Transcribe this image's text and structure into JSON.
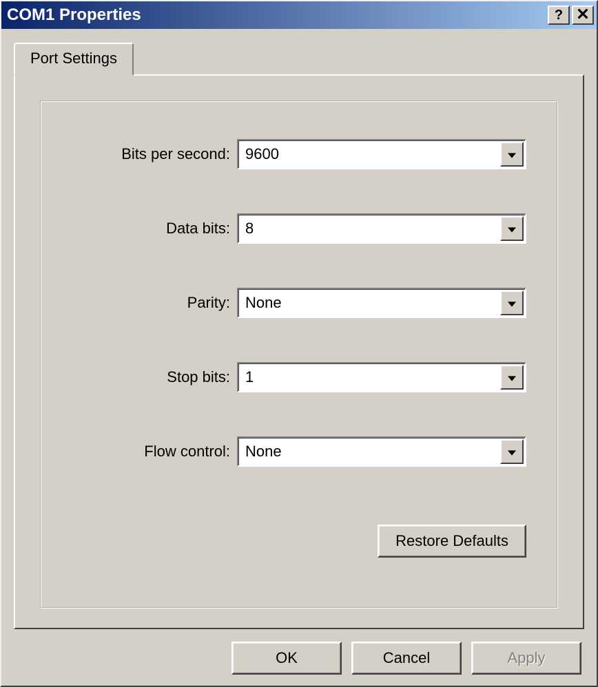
{
  "window": {
    "title": "COM1 Properties"
  },
  "tab": {
    "label": "Port Settings"
  },
  "fields": {
    "bits_per_second": {
      "label": "Bits per second:",
      "value": "9600"
    },
    "data_bits": {
      "label": "Data bits:",
      "value": "8"
    },
    "parity": {
      "label": "Parity:",
      "value": "None"
    },
    "stop_bits": {
      "label": "Stop bits:",
      "value": "1"
    },
    "flow_control": {
      "label": "Flow control:",
      "value": "None"
    }
  },
  "buttons": {
    "restore_defaults": "Restore Defaults",
    "ok": "OK",
    "cancel": "Cancel",
    "apply": "Apply"
  }
}
